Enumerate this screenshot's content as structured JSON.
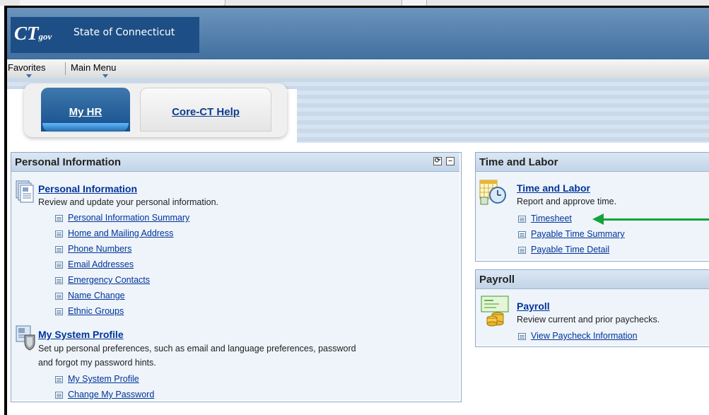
{
  "header": {
    "logo_ct": "CT",
    "logo_gov": "gov",
    "state_name": "State of Connecticut"
  },
  "menubar": {
    "favorites": "Favorites",
    "main_menu": "Main Menu"
  },
  "tabs": [
    {
      "label": "My HR",
      "active": true
    },
    {
      "label": "Core-CT Help",
      "active": false
    }
  ],
  "personal_pagelet": {
    "title": "Personal Information",
    "refresh_icon": "refresh-icon",
    "collapse_icon": "minimize-icon",
    "sections": [
      {
        "title": "Personal Information",
        "description": "Review and update your personal information.",
        "links": [
          "Personal Information Summary",
          "Home and Mailing Address",
          "Phone Numbers",
          "Email Addresses",
          "Emergency Contacts",
          "Name Change",
          "Ethnic Groups"
        ]
      },
      {
        "title": "My System Profile",
        "description_line1": "Set up personal preferences, such as email and language preferences, password",
        "description_line2": "and forgot my password hints.",
        "links": [
          "My System Profile",
          "Change My Password"
        ]
      }
    ]
  },
  "time_pagelet": {
    "title": "Time and Labor",
    "section_title": "Time and Labor",
    "description": "Report and approve time.",
    "links": [
      "Timesheet",
      "Payable Time Summary",
      "Payable Time Detail"
    ]
  },
  "payroll_pagelet": {
    "title": "Payroll",
    "section_title": "Payroll",
    "description": "Review current and prior paychecks.",
    "links": [
      "View Paycheck Information"
    ]
  },
  "colors": {
    "banner": "#41709f",
    "logo_bg": "#1d4f86",
    "link": "#003399",
    "annotation_arrow": "#12a33a"
  }
}
